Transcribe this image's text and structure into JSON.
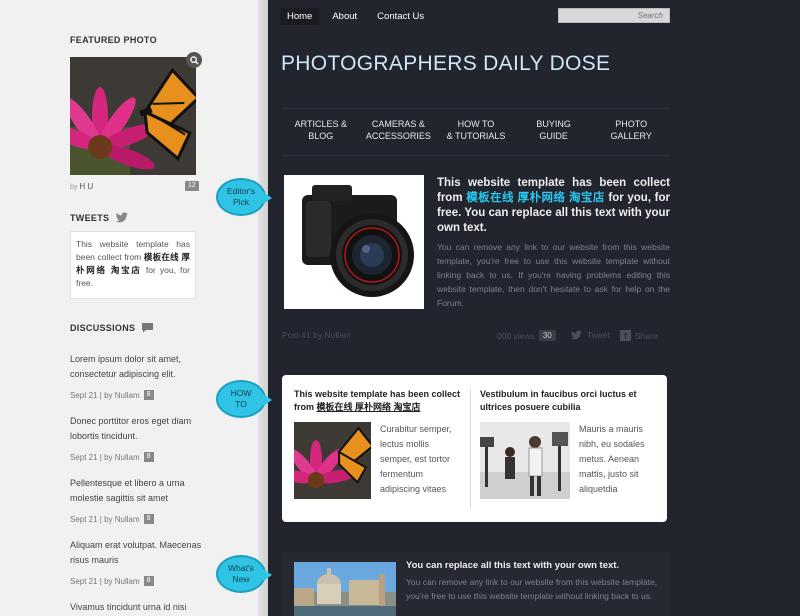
{
  "sidebar": {
    "featured_heading": "FEATURED PHOTO",
    "photo_by_prefix": "by",
    "photo_by_name": "H U",
    "photo_count": "12",
    "tweets_heading": "TWEETS",
    "tweet": {
      "text_before": "This website template has been collect from",
      "text_bold": "模板在线 厚朴网络 淘宝店",
      "text_after": "for you, for free."
    },
    "discussions_heading": "DISCUSSIONS",
    "discussions": [
      {
        "title": "Lorem ipsum dolor sit amet, consectetur adipiscing elit.",
        "meta": "Sept 21 | by Nullam",
        "count": "8"
      },
      {
        "title": "Donec porttitor eros eget diam lobortis tincidunt.",
        "meta": "Sept 21 | by Nullam",
        "count": "8"
      },
      {
        "title": "Pellentesque et libero a urna molestie sagittis sit amet",
        "meta": "Sept 21 | by Nullam",
        "count": "8"
      },
      {
        "title": "Aliquam erat volutpat. Maecenas risus mauris",
        "meta": "Sept 21 | by Nullam",
        "count": "8"
      },
      {
        "title": "Vivamus tincidunt urna id nisi",
        "meta": "",
        "count": ""
      }
    ]
  },
  "topnav": {
    "items": [
      "Home",
      "About",
      "Contact Us"
    ],
    "search_placeholder": "Search"
  },
  "site_title": "PHOTOGRAPHERS DAILY DOSE",
  "categories": [
    {
      "line1": "ARTICLES &",
      "line2": "BLOG"
    },
    {
      "line1": "CAMERAS &",
      "line2": "ACCESSORIES"
    },
    {
      "line1": "HOW TO",
      "line2": "& TUTORIALS"
    },
    {
      "line1": "BUYING",
      "line2": "GUIDE"
    },
    {
      "line1": "PHOTO",
      "line2": "GALLERY"
    }
  ],
  "bubbles": {
    "editors_pick_1": "Editor's",
    "editors_pick_2": "Pick",
    "howto_1": "HOW",
    "howto_2": "TO",
    "whatsnew_1": "What's",
    "whatsnew_2": "New"
  },
  "featured_post": {
    "title_before": "This website template has been collect from",
    "title_cn": "模板在线 厚朴网络 淘宝店",
    "title_after": "for you, for free. You can replace all this text with your own text.",
    "body": "You can remove any link to our website from this website template, you're free to use this website template without linking back to us. If you're having problems editing this website template, then don't hesitate to ask for help on the Forum.",
    "meta_left": "Post #1 by Nullam",
    "views": "000 views",
    "comments": "30",
    "tweet_label": "Tweet",
    "share_label": "Share"
  },
  "howto_card": {
    "left_title_before": "This website template has been collect from",
    "left_title_cn": "模板在线 厚朴网络 淘宝店",
    "left_text": "Curabitur semper, lectus mollis semper, est tortor fermentum adipiscing vitaes",
    "right_title": "Vestibulum in faucibus orci luctus et ultrices posuere cubilia",
    "right_text": "Mauris a mauris nibh, eu sodales metus. Aenean mattis, justo sit aliquetdia"
  },
  "whats_new": {
    "title": "You can replace all this text with your own text.",
    "body": "You can remove any link to our website from this website template, you're free to use this website template without linking back to us."
  }
}
